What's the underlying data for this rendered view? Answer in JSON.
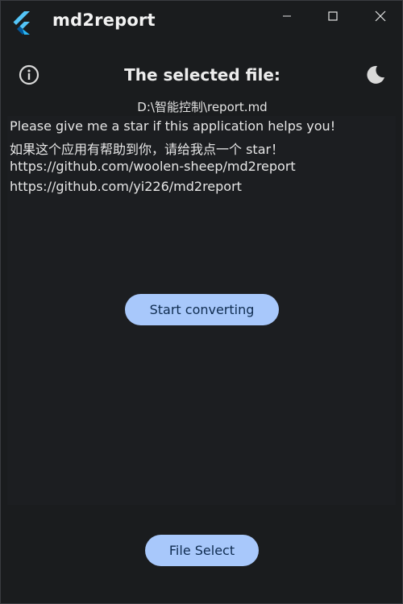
{
  "titlebar": {
    "title": "md2report",
    "logo_icon": "flutter-logo-icon",
    "controls": {
      "minimize_icon": "minimize-icon",
      "maximize_icon": "maximize-icon",
      "close_icon": "close-icon"
    }
  },
  "header": {
    "info_icon": "info-icon",
    "theme_icon": "moon-icon",
    "heading": "The selected file:",
    "file_path": "D:\\智能控制\\report.md"
  },
  "content": {
    "lines": [
      "Please give me a star if this application helps you!",
      "如果这个应用有帮助到你，请给我点一个 star！",
      "https://github.com/woolen-sheep/md2report",
      "https://github.com/yi226/md2report"
    ]
  },
  "actions": {
    "start_label": "Start converting",
    "file_select_label": "File Select"
  },
  "colors": {
    "background": "#1a1c1e",
    "button_bg": "#a8c8fb",
    "button_text": "#0f2c50",
    "flutter_light": "#54c5f8",
    "flutter_dark": "#01579b"
  }
}
